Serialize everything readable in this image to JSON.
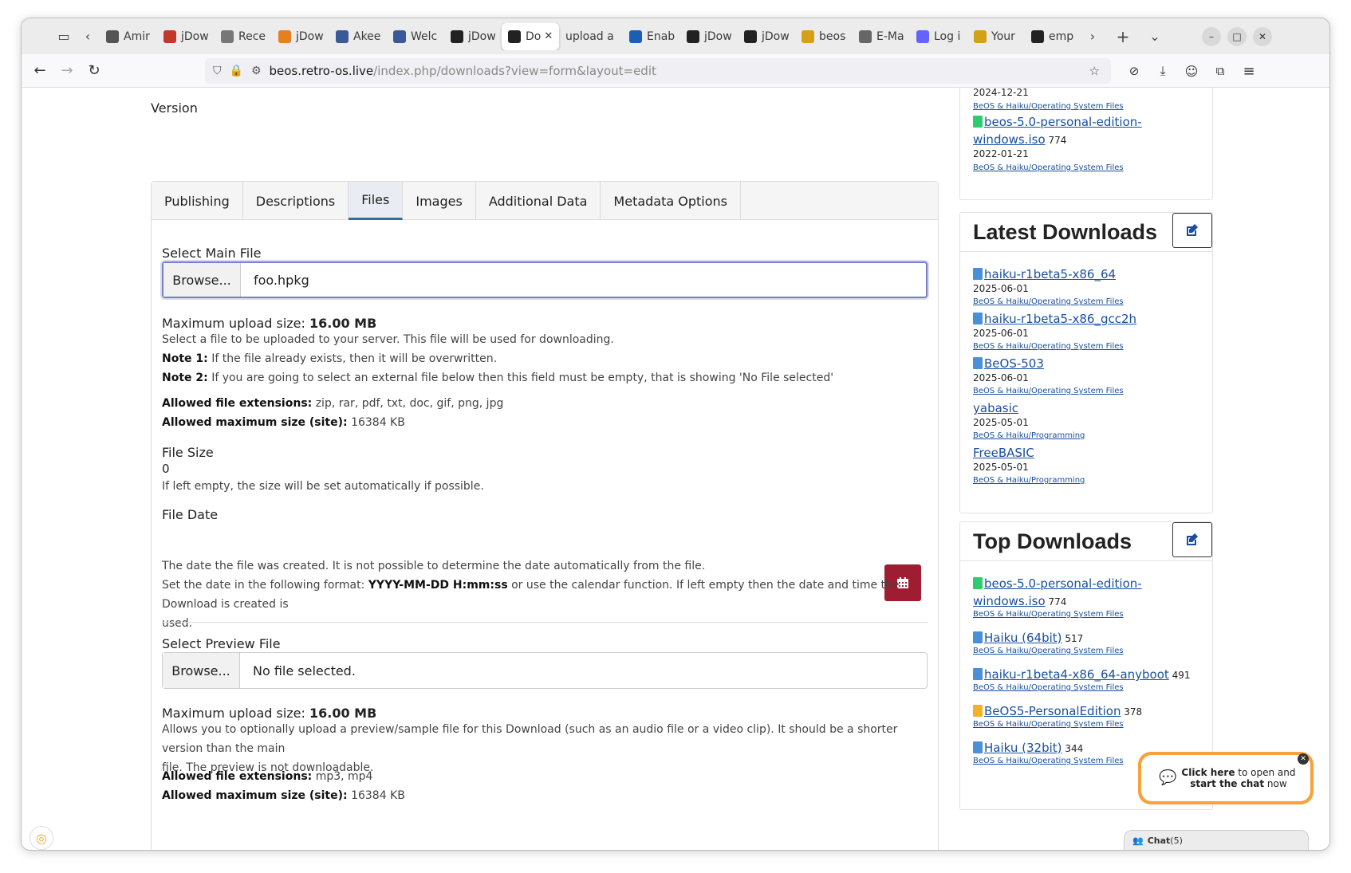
{
  "browser": {
    "tabs": [
      {
        "label": "Amir",
        "color": "#555"
      },
      {
        "label": "jDow",
        "color": "#c0392b"
      },
      {
        "label": "Rece",
        "color": "#777"
      },
      {
        "label": "jDow",
        "color": "#e67e22"
      },
      {
        "label": "Akee",
        "color": "#3b5998"
      },
      {
        "label": "Welc",
        "color": "#3b5998"
      },
      {
        "label": "jDow",
        "color": "#222"
      },
      {
        "label": "Do",
        "color": "#222"
      },
      {
        "label": "upload a",
        "color": ""
      },
      {
        "label": "Enab",
        "color": "#1a5fb4"
      },
      {
        "label": "jDow",
        "color": "#222"
      },
      {
        "label": "jDow",
        "color": "#222"
      },
      {
        "label": "beos",
        "color": "#d4a017"
      },
      {
        "label": "E-Ma",
        "color": "#666"
      },
      {
        "label": "Log i",
        "color": "#6364ff"
      },
      {
        "label": "Your",
        "color": "#d4a017"
      },
      {
        "label": "emp",
        "color": "#222"
      }
    ],
    "url_domain": "beos.retro-os.live",
    "url_path": "/index.php/downloads?view=form&layout=edit"
  },
  "form": {
    "version_label": "Version",
    "tabs": [
      "Publishing",
      "Descriptions",
      "Files",
      "Images",
      "Additional Data",
      "Metadata Options"
    ],
    "main_file": {
      "label": "Select Main File",
      "browse": "Browse...",
      "value": "foo.hpkg",
      "max_prefix": "Maximum upload size: ",
      "max_value": "16.00 MB",
      "desc": "Select a file to be uploaded to your server. This file will be used for downloading.",
      "note1_label": "Note 1:",
      "note1": " If the file already exists, then it will be overwritten.",
      "note2_label": "Note 2:",
      "note2": " If you are going to select an external file below then this field must be empty, that is showing 'No File selected'",
      "ext_label": "Allowed file extensions:",
      "ext": " zip, rar, pdf, txt, doc, gif, png, jpg",
      "maxsite_label": "Allowed maximum size (site):",
      "maxsite": " 16384 KB"
    },
    "file_size": {
      "label": "File Size",
      "value": "0",
      "help": "If left empty, the size will be set automatically if possible."
    },
    "file_date": {
      "label": "File Date",
      "help1": "The date the file was created. It is not possible to determine the date automatically from the file.",
      "help2a": "Set the date in the following format: ",
      "help2b": "YYYY-MM-DD H:mm:ss",
      "help2c": " or use the calendar function. If left empty then the date and time the Download is created is",
      "help2d": "used."
    },
    "preview": {
      "label": "Select Preview File",
      "browse": "Browse...",
      "value": "No file selected.",
      "max_prefix": "Maximum upload size: ",
      "max_value": "16.00 MB",
      "desc1": "Allows you to optionally upload a preview/sample file for this Download (such as an audio file or a video clip). It should be a shorter version than the main",
      "desc2": "file. The preview is not downloadable.",
      "ext_label": "Allowed file extensions:",
      "ext": " mp3, mp4",
      "maxsite_label": "Allowed maximum size (site):",
      "maxsite": " 16384 KB"
    }
  },
  "sidebar": {
    "top_partial": {
      "date1": "2024-12-21",
      "cat1": "BeOS & Haiku/Operating System Files",
      "item": "beos-5.0-personal-edition-",
      "item2": "windows.iso",
      "count": " 774",
      "date2": "2022-01-21",
      "cat2": "BeOS & Haiku/Operating System Files"
    },
    "latest": {
      "title": "Latest Downloads",
      "items": [
        {
          "name": "haiku-r1beta5-x86_64",
          "date": "2025-06-01",
          "cat": "BeOS & Haiku/Operating System Files",
          "icon": "#4a90d9"
        },
        {
          "name": "haiku-r1beta5-x86_gcc2h",
          "date": "2025-06-01",
          "cat": "BeOS & Haiku/Operating System Files",
          "icon": "#4a90d9"
        },
        {
          "name": "BeOS-503",
          "date": "2025-06-01",
          "cat": "BeOS & Haiku/Operating System Files",
          "icon": "#4a90d9"
        },
        {
          "name": "yabasic",
          "date": "2025-05-01",
          "cat": "BeOS & Haiku/Programming",
          "icon": ""
        },
        {
          "name": "FreeBASIC",
          "date": "2025-05-01",
          "cat": "BeOS & Haiku/Programming",
          "icon": ""
        }
      ]
    },
    "top": {
      "title": "Top Downloads",
      "items": [
        {
          "name": "beos-5.0-personal-edition-",
          "name2": "windows.iso",
          "count": " 774",
          "cat": "BeOS & Haiku/Operating System Files",
          "icon": "#2ecc71"
        },
        {
          "name": "Haiku (64bit)",
          "count": " 517",
          "cat": "BeOS & Haiku/Operating System Files",
          "icon": "#4a90d9"
        },
        {
          "name": "haiku-r1beta4-x86_64-anyboot",
          "count": " 491",
          "cat": "BeOS & Haiku/Operating System Files",
          "icon": "#4a90d9"
        },
        {
          "name": "BeOS5-PersonalEdition",
          "count": " 378",
          "cat": "BeOS & Haiku/Operating System Files",
          "icon": "#f0b030"
        },
        {
          "name": "Haiku (32bit)",
          "count": " 344",
          "cat": "BeOS & Haiku/Operating System Files",
          "icon": "#4a90d9"
        }
      ]
    }
  },
  "chat": {
    "bubble_b1": "Click here",
    "bubble_t1": " to open and",
    "bubble_b2": "start the chat",
    "bubble_t2": " now",
    "bar": "Chat",
    "bar_count": " (5)"
  }
}
